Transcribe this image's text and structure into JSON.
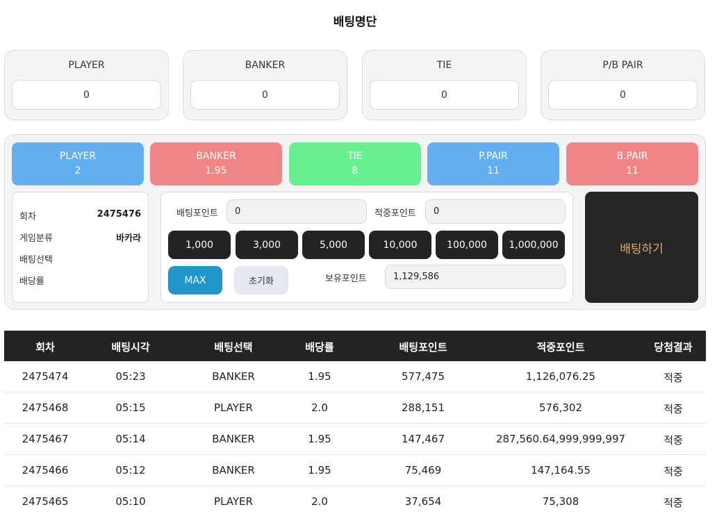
{
  "title": "배팅명단",
  "tallies": [
    {
      "label": "PLAYER",
      "value": "0"
    },
    {
      "label": "BANKER",
      "value": "0"
    },
    {
      "label": "TIE",
      "value": "0"
    },
    {
      "label": "P/B PAIR",
      "value": "0"
    }
  ],
  "options": [
    {
      "name": "PLAYER",
      "odds": "2",
      "color": "#63aef0"
    },
    {
      "name": "BANKER",
      "odds": "1.95",
      "color": "#f08585"
    },
    {
      "name": "TIE",
      "odds": "8",
      "color": "#66f08f"
    },
    {
      "name": "P.PAIR",
      "odds": "11",
      "color": "#63aef0"
    },
    {
      "name": "B.PAIR",
      "odds": "11",
      "color": "#f08585"
    }
  ],
  "info": {
    "round_label": "회차",
    "round_value": "2475476",
    "game_label": "게임분류",
    "game_value": "바카라",
    "choice_label": "배팅선택",
    "choice_value": "",
    "rate_label": "배당률",
    "rate_value": ""
  },
  "form": {
    "bet_points_label": "배팅포인트",
    "bet_points_value": "0",
    "win_points_label": "적중포인트",
    "win_points_value": "0",
    "chips": [
      "1,000",
      "3,000",
      "5,000",
      "10,000",
      "100,000",
      "1,000,000"
    ],
    "max_label": "MAX",
    "reset_label": "초기화",
    "balance_label": "보유포인트",
    "balance_value": "1,129,586"
  },
  "bet_button": "배팅하기",
  "history": {
    "columns": [
      "회차",
      "배팅시각",
      "배팅선택",
      "배당률",
      "배팅포인트",
      "적중포인트",
      "당첨결과"
    ],
    "rows": [
      [
        "2475474",
        "05:23",
        "BANKER",
        "1.95",
        "577,475",
        "1,126,076.25",
        "적중"
      ],
      [
        "2475468",
        "05:15",
        "PLAYER",
        "2.0",
        "288,151",
        "576,302",
        "적중"
      ],
      [
        "2475467",
        "05:14",
        "BANKER",
        "1.95",
        "147,467",
        "287,560.64,999,999,997",
        "적중"
      ],
      [
        "2475466",
        "05:12",
        "BANKER",
        "1.95",
        "75,469",
        "147,164.55",
        "적중"
      ],
      [
        "2475465",
        "05:10",
        "PLAYER",
        "2.0",
        "37,654",
        "75,308",
        "적중"
      ]
    ]
  },
  "colors": {
    "accent_max": "#2196c9",
    "bet_button_text": "#e2a86b",
    "table_header": "#232323"
  }
}
